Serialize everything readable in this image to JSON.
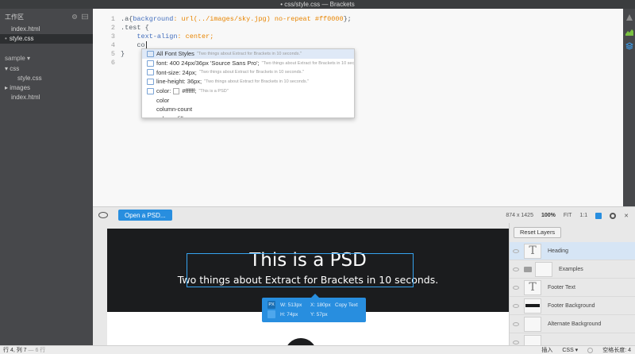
{
  "window": {
    "title": "• css/style.css — Brackets"
  },
  "sidebar": {
    "working_files_title": "工作区",
    "working_files": [
      {
        "name": "index.html",
        "active": false
      },
      {
        "name": "style.css",
        "active": true
      }
    ],
    "project_title": "sample ▾",
    "tree": [
      {
        "label": "▾ css",
        "indent": 0
      },
      {
        "label": "style.css",
        "indent": 2
      },
      {
        "label": "▸ images",
        "indent": 0
      },
      {
        "label": "index.html",
        "indent": 1
      }
    ]
  },
  "editor": {
    "line_numbers": [
      "1",
      "2",
      "3",
      "4",
      "5",
      "6"
    ],
    "lines": {
      "l1_selector": ".a",
      "l1_open": "{",
      "l1_prop": "background",
      "l1_value": ": url(../images/sky.jpg) no-repeat #ff0000",
      "l1_close": "};",
      "l2": ".test {",
      "l3_prop": "text-align",
      "l3_value": ": center;",
      "l4": "co",
      "l5": "}"
    }
  },
  "code_hints": {
    "items": [
      {
        "main": "All Font Styles",
        "note": "\"Two things about Extract for Brackets in 10 seconds.\"",
        "icon": true,
        "active": true
      },
      {
        "main": "font: 400 24px/36px 'Source Sans Pro';",
        "note": "\"Two things about Extract for Brackets in 10 seconds.\"",
        "icon": true
      },
      {
        "main": "font-size: 24px;",
        "note": "\"Two things about Extract for Brackets in 10 seconds.\"",
        "icon": true
      },
      {
        "main": "line-height: 36px;",
        "note": "\"Two things about Extract for Brackets in 10 seconds.\"",
        "icon": true
      },
      {
        "main": "color:",
        "value": "#ffffff;",
        "note": "\"This is a PSD\"",
        "icon": true,
        "swatch": true
      },
      {
        "main": "color",
        "note": "",
        "icon": false
      },
      {
        "main": "column-count",
        "note": "",
        "icon": false
      },
      {
        "main": "column-fill",
        "note": "",
        "icon": false
      }
    ]
  },
  "extract_panel": {
    "open_button": "Open a PSD...",
    "dimensions": "874 x 1425",
    "zoom": "100%",
    "fit": "FIT",
    "ratio": "1:1"
  },
  "psd": {
    "heading": "This is a PSD",
    "subheading": "Two things about Extract for Brackets in 10 seconds.",
    "info": {
      "unit": "PX",
      "w": "W: 513px",
      "h": "H: 74px",
      "x": "X: 180px",
      "y": "Y: 57px",
      "copy_text": "Copy Text"
    }
  },
  "layers": {
    "reset_button": "Reset Layers",
    "items": [
      {
        "name": "Heading",
        "thumb": "T",
        "active": true
      },
      {
        "name": "Examples",
        "thumb": "folder"
      },
      {
        "name": "Footer Text",
        "thumb": "T"
      },
      {
        "name": "Footer Background",
        "thumb": "bar"
      },
      {
        "name": "Alternate Background",
        "thumb": "blank"
      },
      {
        "name": "",
        "thumb": "blank"
      }
    ]
  },
  "statusbar": {
    "position": "行 4, 列 7",
    "lines": " — 6 行",
    "mode": "插入",
    "language": "CSS ▾",
    "indent": "空格长度: 4"
  },
  "colors": {
    "accent": "#288edf",
    "sidebar_bg": "#47484b",
    "editor_bg": "#f8f8f8",
    "psd_dark": "#1b1c1e"
  }
}
